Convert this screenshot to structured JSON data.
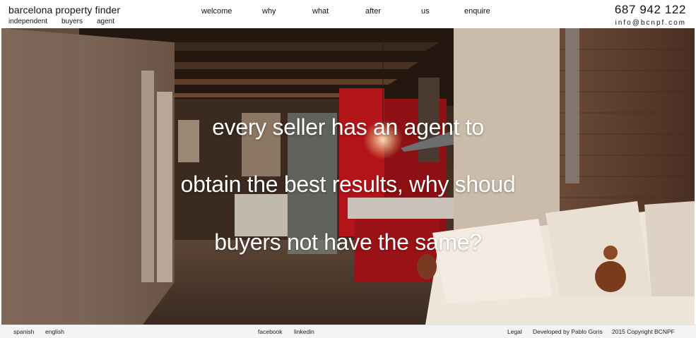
{
  "header": {
    "brand_title": "barcelona property finder",
    "tagline": [
      "independent",
      "buyers",
      "agent"
    ],
    "phone": "687 942 122",
    "email": "info@bcnpf.com"
  },
  "nav": {
    "items": [
      "welcome",
      "why",
      "what",
      "after",
      "us",
      "enquire"
    ]
  },
  "hero": {
    "headline_lines": [
      "every seller has an agent to",
      "obtain the best results, why shoud",
      "buyers not have the same?"
    ]
  },
  "footer": {
    "languages": [
      "spanish",
      "english"
    ],
    "social": [
      "facebook",
      "linkedin"
    ],
    "legal": "Legal",
    "developer": "Developed by Pablo Goris",
    "copyright": "2015 Copyright BCNPF"
  },
  "colors": {
    "headline_text": "#ffffff",
    "kitchen_red": "#b3141a",
    "brick": "#5a3a2a",
    "sofa_cream": "#efe6da"
  }
}
